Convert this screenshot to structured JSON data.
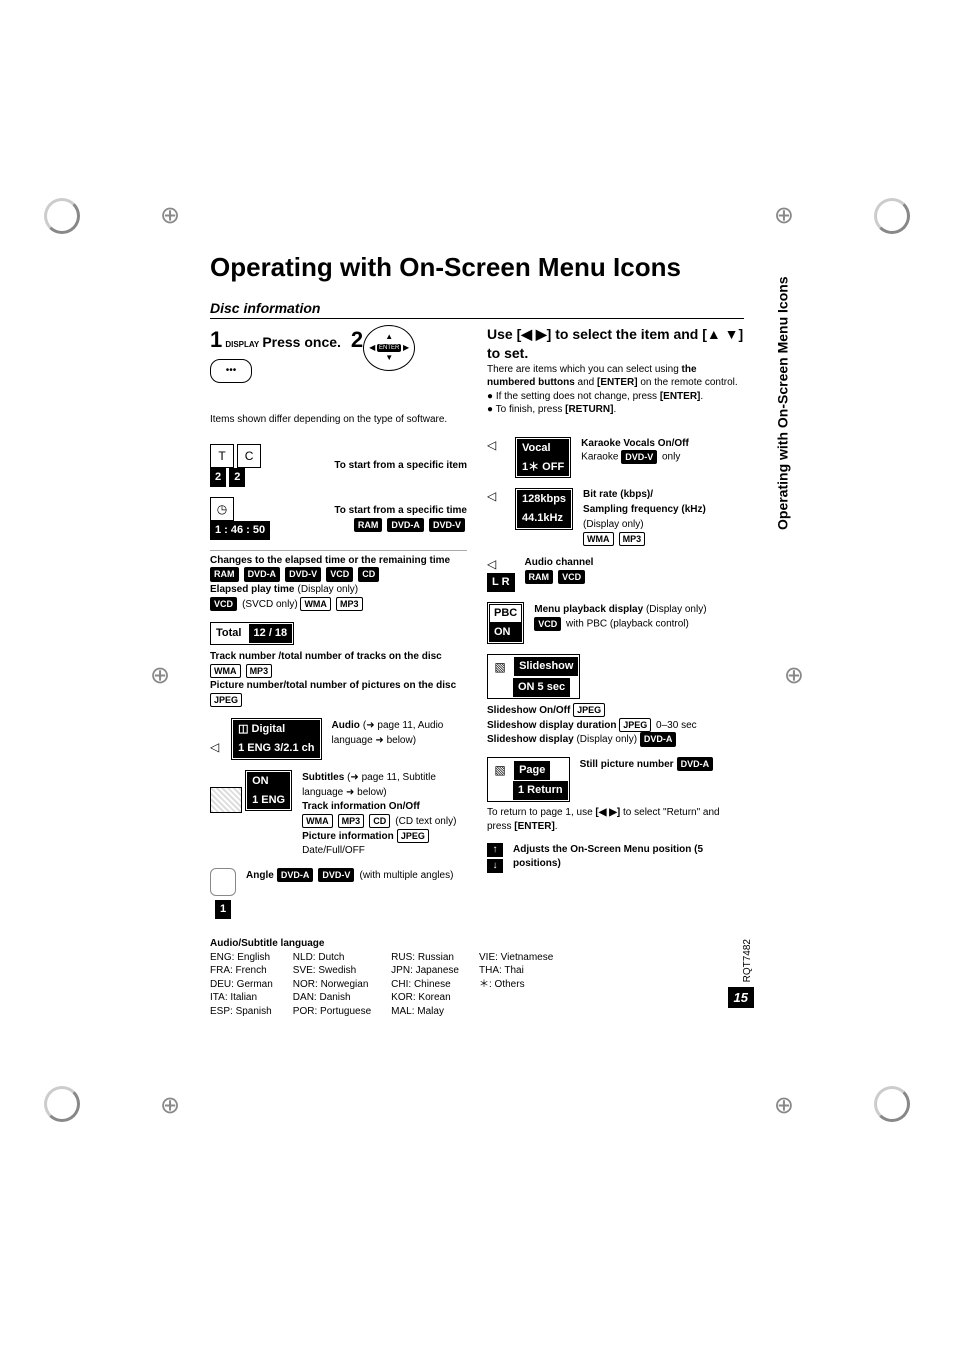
{
  "side_label": "Operating with On-Screen Menu Icons",
  "title": "Operating with On-Screen Menu Icons",
  "subtitle": "Disc information",
  "step1": {
    "num": "1",
    "caption": "DISPLAY",
    "action": "Press once.",
    "button_glyph": "•••"
  },
  "step2": {
    "num": "2",
    "enter_label": "ENTER",
    "left_note": "Items shown differ depending on the type of software.",
    "right_head": "Use [◀ ▶] to select the item and [▲ ▼] to set.",
    "right_p1a": "There are items which you can select using ",
    "right_p1b": "the numbered buttons",
    "right_p1c": " and ",
    "right_p1d": "[ENTER]",
    "right_p1e": " on the remote control.",
    "right_b1": "● If the setting does not change, press ",
    "right_b1k": "[ENTER]",
    "right_b1e": ".",
    "right_b2": "● To finish, press ",
    "right_b2k": "[RETURN]",
    "right_b2e": "."
  },
  "left": {
    "specific_item": {
      "osd1": "2",
      "osd2": "2",
      "label": "To start from a specific item"
    },
    "specific_time": {
      "osd": "1 : 46 : 50",
      "label": "To start from a specific time",
      "tags": [
        "RAM",
        "DVD-A",
        "DVD-V"
      ]
    },
    "elapsed": {
      "line1": "Changes to the elapsed time or the remaining time",
      "tags1": [
        "RAM",
        "DVD-A",
        "DVD-V",
        "VCD",
        "CD"
      ],
      "label2": "Elapsed play time",
      "label2_suffix": " (Display only)",
      "tags2_first": "VCD",
      "tags2_suffix": " (SVCD only) ",
      "tags2_rest": [
        "WMA",
        "MP3"
      ]
    },
    "total": {
      "osd_title": "Total",
      "osd_val": "12 / 18",
      "line1a": "Track number /total number of tracks on the disc",
      "tags1": [
        "WMA",
        "MP3"
      ],
      "line2a": "Picture number/total number of pictures on the disc",
      "tags2": [
        "JPEG"
      ]
    },
    "audio": {
      "osd_top": "Digital",
      "osd_bot": "1 ENG 3/2.1 ch",
      "label": "Audio",
      "ref": " (➜ page 11, Audio language ➜ below)"
    },
    "subtitle": {
      "osd_top": "ON",
      "osd_bot": "1 ENG",
      "l1": "Subtitles",
      "l1ref": " (➜ page 11, Subtitle language ➜ below)",
      "l2": "Track information On/Off",
      "l2_tags": [
        "WMA",
        "MP3",
        "CD"
      ],
      "l2_suffix": " (CD text only)",
      "l3": "Picture information",
      "l3_tags": [
        "JPEG"
      ],
      "l4": "Date/Full/OFF"
    },
    "anglerow": {
      "osd": "1",
      "label": "Angle",
      "tags": [
        "DVD-A",
        "DVD-V"
      ],
      "suffix": " (with multiple angles)"
    }
  },
  "right": {
    "vocal": {
      "osd_top": "Vocal",
      "osd_bot": "1＊    OFF",
      "label": "Karaoke Vocals On/Off",
      "sub": "Karaoke ",
      "tag": "DVD-V",
      "suffix": " only"
    },
    "bitrate": {
      "osd_top": "128kbps",
      "osd_bot": "44.1kHz",
      "l1": "Bit rate (kbps)/",
      "l2": "Sampling frequency (kHz)",
      "l2_suffix": " (Display only)",
      "tags": [
        "WMA",
        "MP3"
      ]
    },
    "audio_ch": {
      "osd": "L R",
      "label": "Audio channel",
      "tags": [
        "RAM",
        "VCD"
      ]
    },
    "pbc": {
      "osd_top": "PBC",
      "osd_bot": "ON",
      "l1": "Menu playback display",
      "l1_suffix": " (Display only)",
      "tag": "VCD",
      "suffix": " with PBC (playback control)"
    },
    "slideshow": {
      "osd_title": "Slideshow",
      "osd_val": "ON    5 sec",
      "l1": "Slideshow On/Off ",
      "l1_tag": "JPEG",
      "l2": "Slideshow display duration ",
      "l2_tag": "JPEG",
      "l2_suffix": " 0–30 sec",
      "l3": "Slideshow display",
      "l3_suffix": " (Display only) ",
      "l3_tag": "DVD-A"
    },
    "page": {
      "osd_title": "Page",
      "osd_val": "1    Return",
      "label": "Still picture number",
      "tag": "DVD-A",
      "ret_a": "To return to page 1, use ",
      "ret_key": "[◀ ▶]",
      "ret_b": " to select \"Return\" and press ",
      "ret_key2": "[ENTER]",
      "ret_c": "."
    },
    "position": {
      "l1": "Adjusts the On-Screen Menu position (5 positions)"
    }
  },
  "langs": {
    "heading": "Audio/Subtitle language",
    "col1": [
      "ENG: English",
      "FRA: French",
      "DEU: German",
      "ITA: Italian",
      "ESP: Spanish"
    ],
    "col2": [
      "NLD: Dutch",
      "SVE: Swedish",
      "NOR: Norwegian",
      "DAN: Danish",
      "POR: Portuguese"
    ],
    "col3": [
      "RUS: Russian",
      "JPN: Japanese",
      "CHI: Chinese",
      "KOR: Korean",
      "MAL: Malay"
    ],
    "col4": [
      "VIE: Vietnamese",
      "THA: Thai",
      "＊: Others"
    ]
  },
  "footer": {
    "code": "RQT7482",
    "page": "15"
  }
}
